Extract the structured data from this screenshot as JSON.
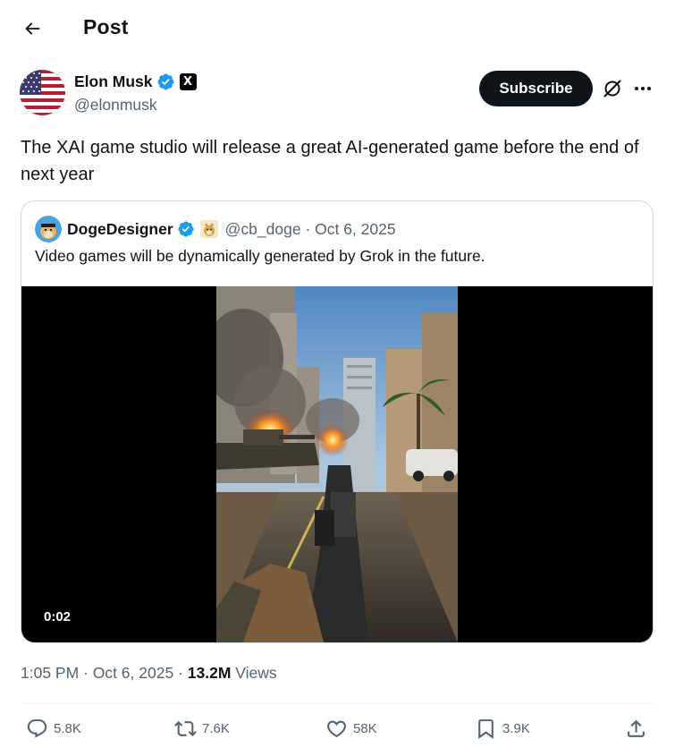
{
  "header": {
    "title": "Post"
  },
  "author": {
    "name": "Elon Musk",
    "handle": "@elonmusk",
    "affiliate_badge": "X",
    "subscribe_label": "Subscribe"
  },
  "post": {
    "text": "The XAI game studio will release a great AI-generated game before the end of next year",
    "timestamp": "1:05 PM · Oct 6, 2025",
    "views_count": "13.2M",
    "views_label": "Views"
  },
  "quote": {
    "name": "DogeDesigner",
    "handle": "@cb_doge",
    "date": "Oct 6, 2025",
    "meta": "@cb_doge · Oct 6, 2025",
    "text": "Video games will be dynamically generated by Grok in the future.",
    "video_time": "0:02"
  },
  "actions": {
    "replies": "5.8K",
    "reposts": "7.6K",
    "likes": "58K",
    "bookmarks": "3.9K"
  },
  "icons": [
    "back-arrow-icon",
    "verified-icon",
    "x-logo-icon",
    "grok-icon",
    "more-icon",
    "reply-icon",
    "repost-icon",
    "like-icon",
    "bookmark-icon",
    "share-icon"
  ],
  "colors": {
    "verified": "#1d9bf0",
    "text": "#0f1419",
    "secondary": "#536471",
    "button": "#0f1419"
  }
}
